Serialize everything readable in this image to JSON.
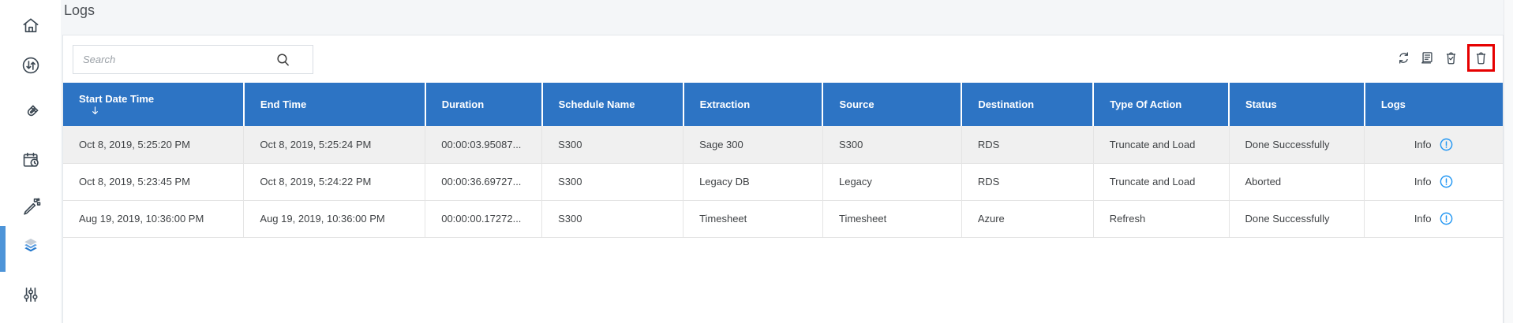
{
  "title": "Logs",
  "sidebar": {
    "items": [
      {
        "icon": "home-icon",
        "active": false
      },
      {
        "icon": "data-transfer-icon",
        "active": false
      },
      {
        "icon": "magnet-icon",
        "active": false
      },
      {
        "icon": "schedule-icon",
        "active": false
      },
      {
        "icon": "wizard-icon",
        "active": false
      },
      {
        "icon": "layers-icon",
        "active": true
      },
      {
        "icon": "settings-sliders-icon",
        "active": false
      }
    ]
  },
  "search": {
    "placeholder": "Search",
    "value": "",
    "icon": "search-icon"
  },
  "toolbar": {
    "icons": [
      "refresh-icon",
      "log-report-icon",
      "clear-logs-icon",
      "delete-icon"
    ],
    "highlighted_icon": "delete-icon",
    "highlight_color": "#e60000"
  },
  "table": {
    "columns": [
      {
        "label": "Start Date Time",
        "sort": "desc"
      },
      {
        "label": "End Time"
      },
      {
        "label": "Duration"
      },
      {
        "label": "Schedule Name"
      },
      {
        "label": "Extraction"
      },
      {
        "label": "Source"
      },
      {
        "label": "Destination"
      },
      {
        "label": "Type Of Action"
      },
      {
        "label": "Status"
      },
      {
        "label": "Logs"
      }
    ],
    "rows": [
      {
        "start_date_time": "Oct 8, 2019, 5:25:20 PM",
        "end_time": "Oct 8, 2019, 5:25:24 PM",
        "duration": "00:00:03.95087...",
        "schedule_name": "S300",
        "extraction": "Sage 300",
        "source": "S300",
        "destination": "RDS",
        "type_of_action": "Truncate and Load",
        "status": "Done Successfully",
        "logs_label": "Info"
      },
      {
        "start_date_time": "Oct 8, 2019, 5:23:45 PM",
        "end_time": "Oct 8, 2019, 5:24:22 PM",
        "duration": "00:00:36.69727...",
        "schedule_name": "S300",
        "extraction": "Legacy DB",
        "source": "Legacy",
        "destination": "RDS",
        "type_of_action": "Truncate and Load",
        "status": "Aborted",
        "logs_label": "Info"
      },
      {
        "start_date_time": "Aug 19, 2019, 10:36:00 PM",
        "end_time": "Aug 19, 2019, 10:36:00 PM",
        "duration": "00:00:00.17272...",
        "schedule_name": "S300",
        "extraction": "Timesheet",
        "source": "Timesheet",
        "destination": "Azure",
        "type_of_action": "Refresh",
        "status": "Done Successfully",
        "logs_label": "Info"
      }
    ]
  },
  "colors": {
    "header_blue": "#2d74c4",
    "accent_bar_blue": "#4d94d8",
    "info_blue": "#2196f3",
    "highlight_red": "#e60000",
    "alt_row_bg": "#f0f0f0"
  }
}
